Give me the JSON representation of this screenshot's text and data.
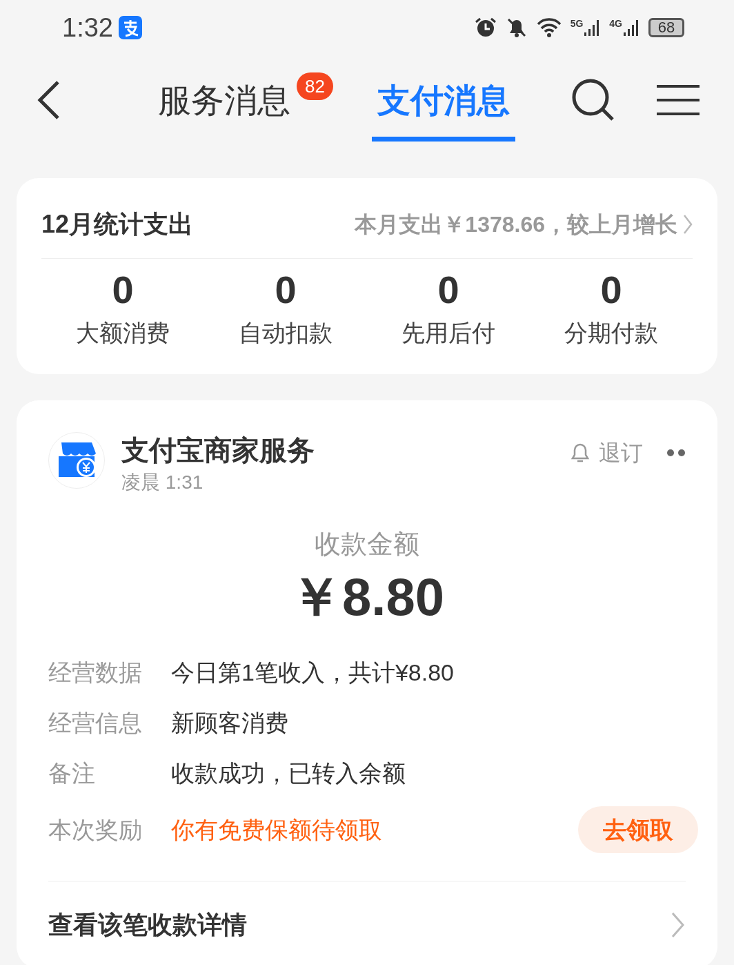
{
  "status_bar": {
    "time": "1:32",
    "net1": "5G",
    "net2": "4G",
    "battery": "68"
  },
  "tabs": [
    {
      "label": "服务消息",
      "badge": "82",
      "selected": false
    },
    {
      "label": "支付消息",
      "selected": true
    }
  ],
  "summary": {
    "title": "12月统计支出",
    "note": "本月支出￥1378.66，较上月增长",
    "stats": [
      {
        "value": "0",
        "label": "大额消费"
      },
      {
        "value": "0",
        "label": "自动扣款"
      },
      {
        "value": "0",
        "label": "先用后付"
      },
      {
        "value": "0",
        "label": "分期付款"
      }
    ]
  },
  "message": {
    "sender": "支付宝商家服务",
    "time": "凌晨 1:31",
    "unsubscribe": "退订",
    "amount_label": "收款金额",
    "amount": "￥8.80",
    "rows": [
      {
        "kind": "text",
        "label": "经营数据",
        "value": "今日第1笔收入，共计¥8.80"
      },
      {
        "kind": "text",
        "label": "经营信息",
        "value": "新顾客消费"
      },
      {
        "kind": "text",
        "label": "备注",
        "value": "收款成功，已转入余额"
      },
      {
        "kind": "reward",
        "label": "本次奖励",
        "value": "你有免费保额待领取",
        "action": "去领取"
      }
    ],
    "footer": "查看该笔收款详情"
  }
}
